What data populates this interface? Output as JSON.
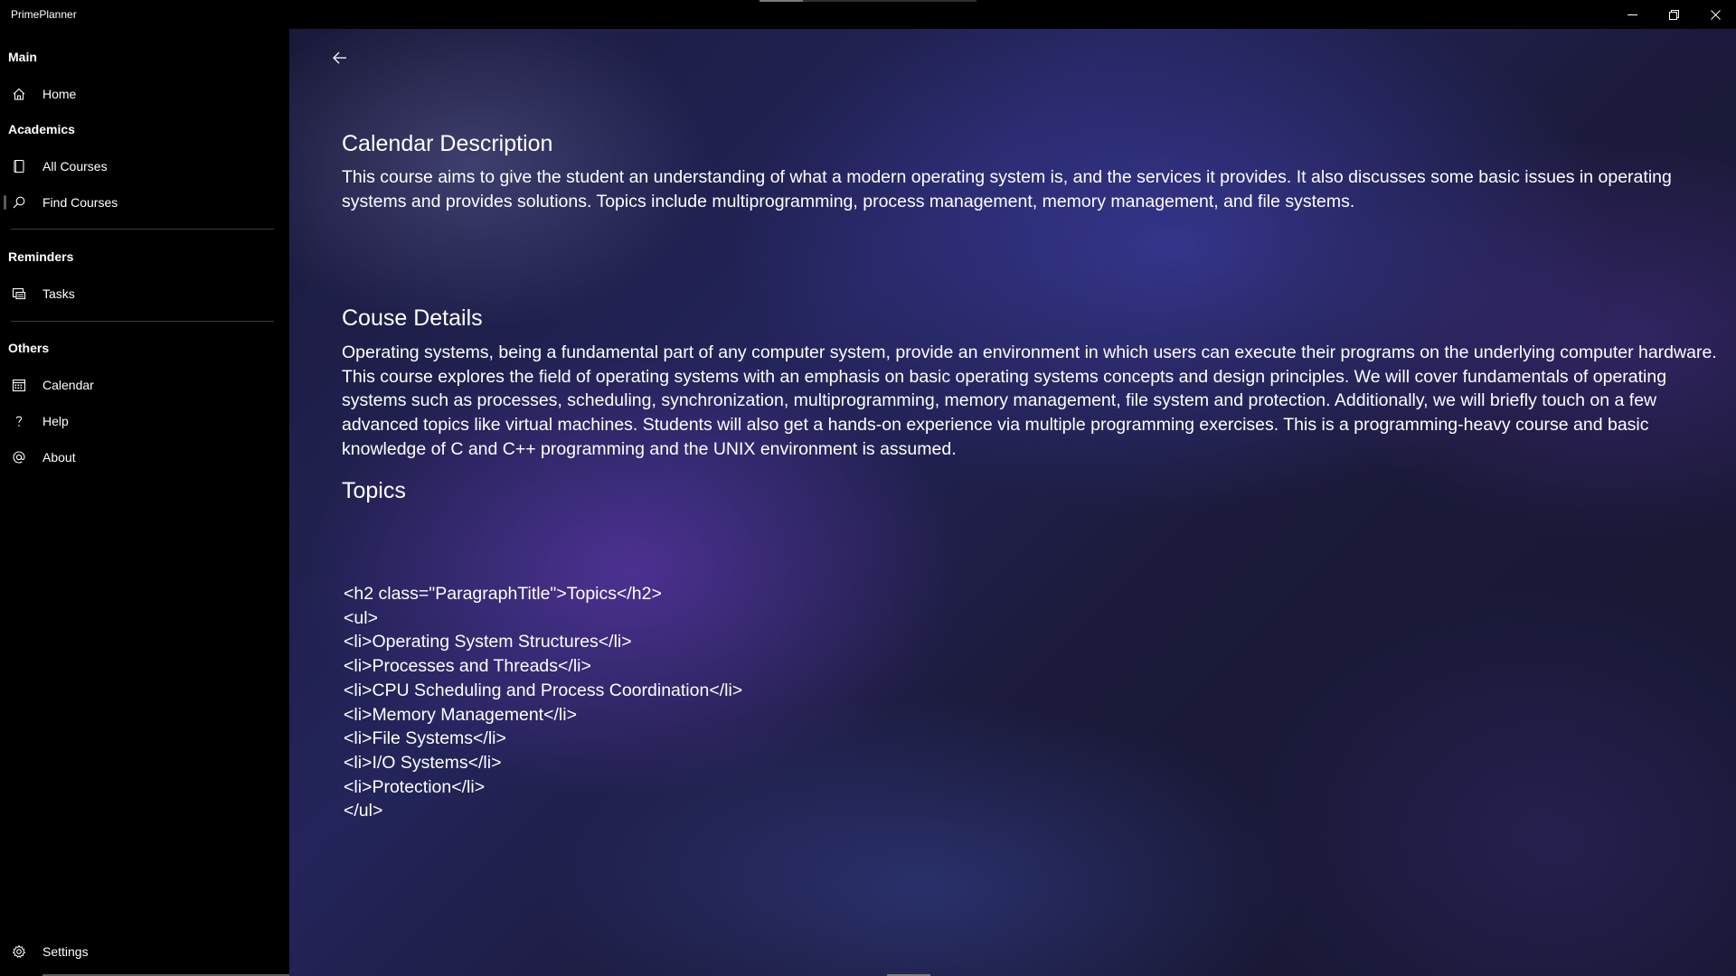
{
  "app": {
    "title": "PrimePlanner"
  },
  "caption": {
    "minimize_icon": "minimize-icon",
    "maximize_icon": "restore-icon",
    "close_icon": "close-icon"
  },
  "sidebar": {
    "sections": [
      {
        "header": "Main",
        "items": [
          {
            "label": "Home",
            "icon": "home-icon"
          }
        ]
      },
      {
        "header": "Academics",
        "items": [
          {
            "label": "All Courses",
            "icon": "book-icon"
          },
          {
            "label": "Find Courses",
            "icon": "search-icon",
            "selected": true
          }
        ]
      },
      {
        "header": "Reminders",
        "items": [
          {
            "label": "Tasks",
            "icon": "tasks-icon"
          }
        ]
      },
      {
        "header": "Others",
        "items": [
          {
            "label": "Calendar",
            "icon": "calendar-icon"
          },
          {
            "label": "Help",
            "icon": "help-icon"
          },
          {
            "label": "About",
            "icon": "at-icon"
          }
        ]
      }
    ],
    "footer": {
      "label": "Settings",
      "icon": "gear-icon"
    }
  },
  "content": {
    "back_icon": "back-arrow-icon",
    "calendar_description": {
      "title": "Calendar Description",
      "text": "This course aims to give the student an understanding of what a modern operating system is, and the services it provides. It also discusses some basic issues in operating systems and provides solutions. Topics include multiprogramming, process management, memory management, and file systems."
    },
    "course_details": {
      "title": "Couse Details",
      "text": "Operating systems, being a fundamental part of any computer system, provide an environment in which users can execute their programs on the underlying computer hardware. This course explores the field of operating systems with an emphasis on basic operating systems concepts and design principles. We will cover fundamentals of operating systems such as processes, scheduling, synchronization, multiprogramming, memory management, file system and protection. Additionally, we will briefly touch on a few advanced topics like virtual machines. Students will also get a hands-on experience via multiple programming exercises. This is a programming-heavy course and basic knowledge of C and C++ programming and the UNIX environment is assumed."
    },
    "topics": {
      "title": "Topics",
      "raw_lines": [
        "<h2 class=\"ParagraphTitle\">Topics</h2>",
        "<ul>",
        "<li>Operating System Structures</li>",
        "<li>Processes and Threads</li>",
        "<li>CPU Scheduling and Process Coordination</li>",
        "<li>Memory Management</li>",
        "<li>File Systems</li>",
        "<li>I/O Systems</li>",
        "<li>Protection</li>",
        "</ul>"
      ]
    }
  }
}
